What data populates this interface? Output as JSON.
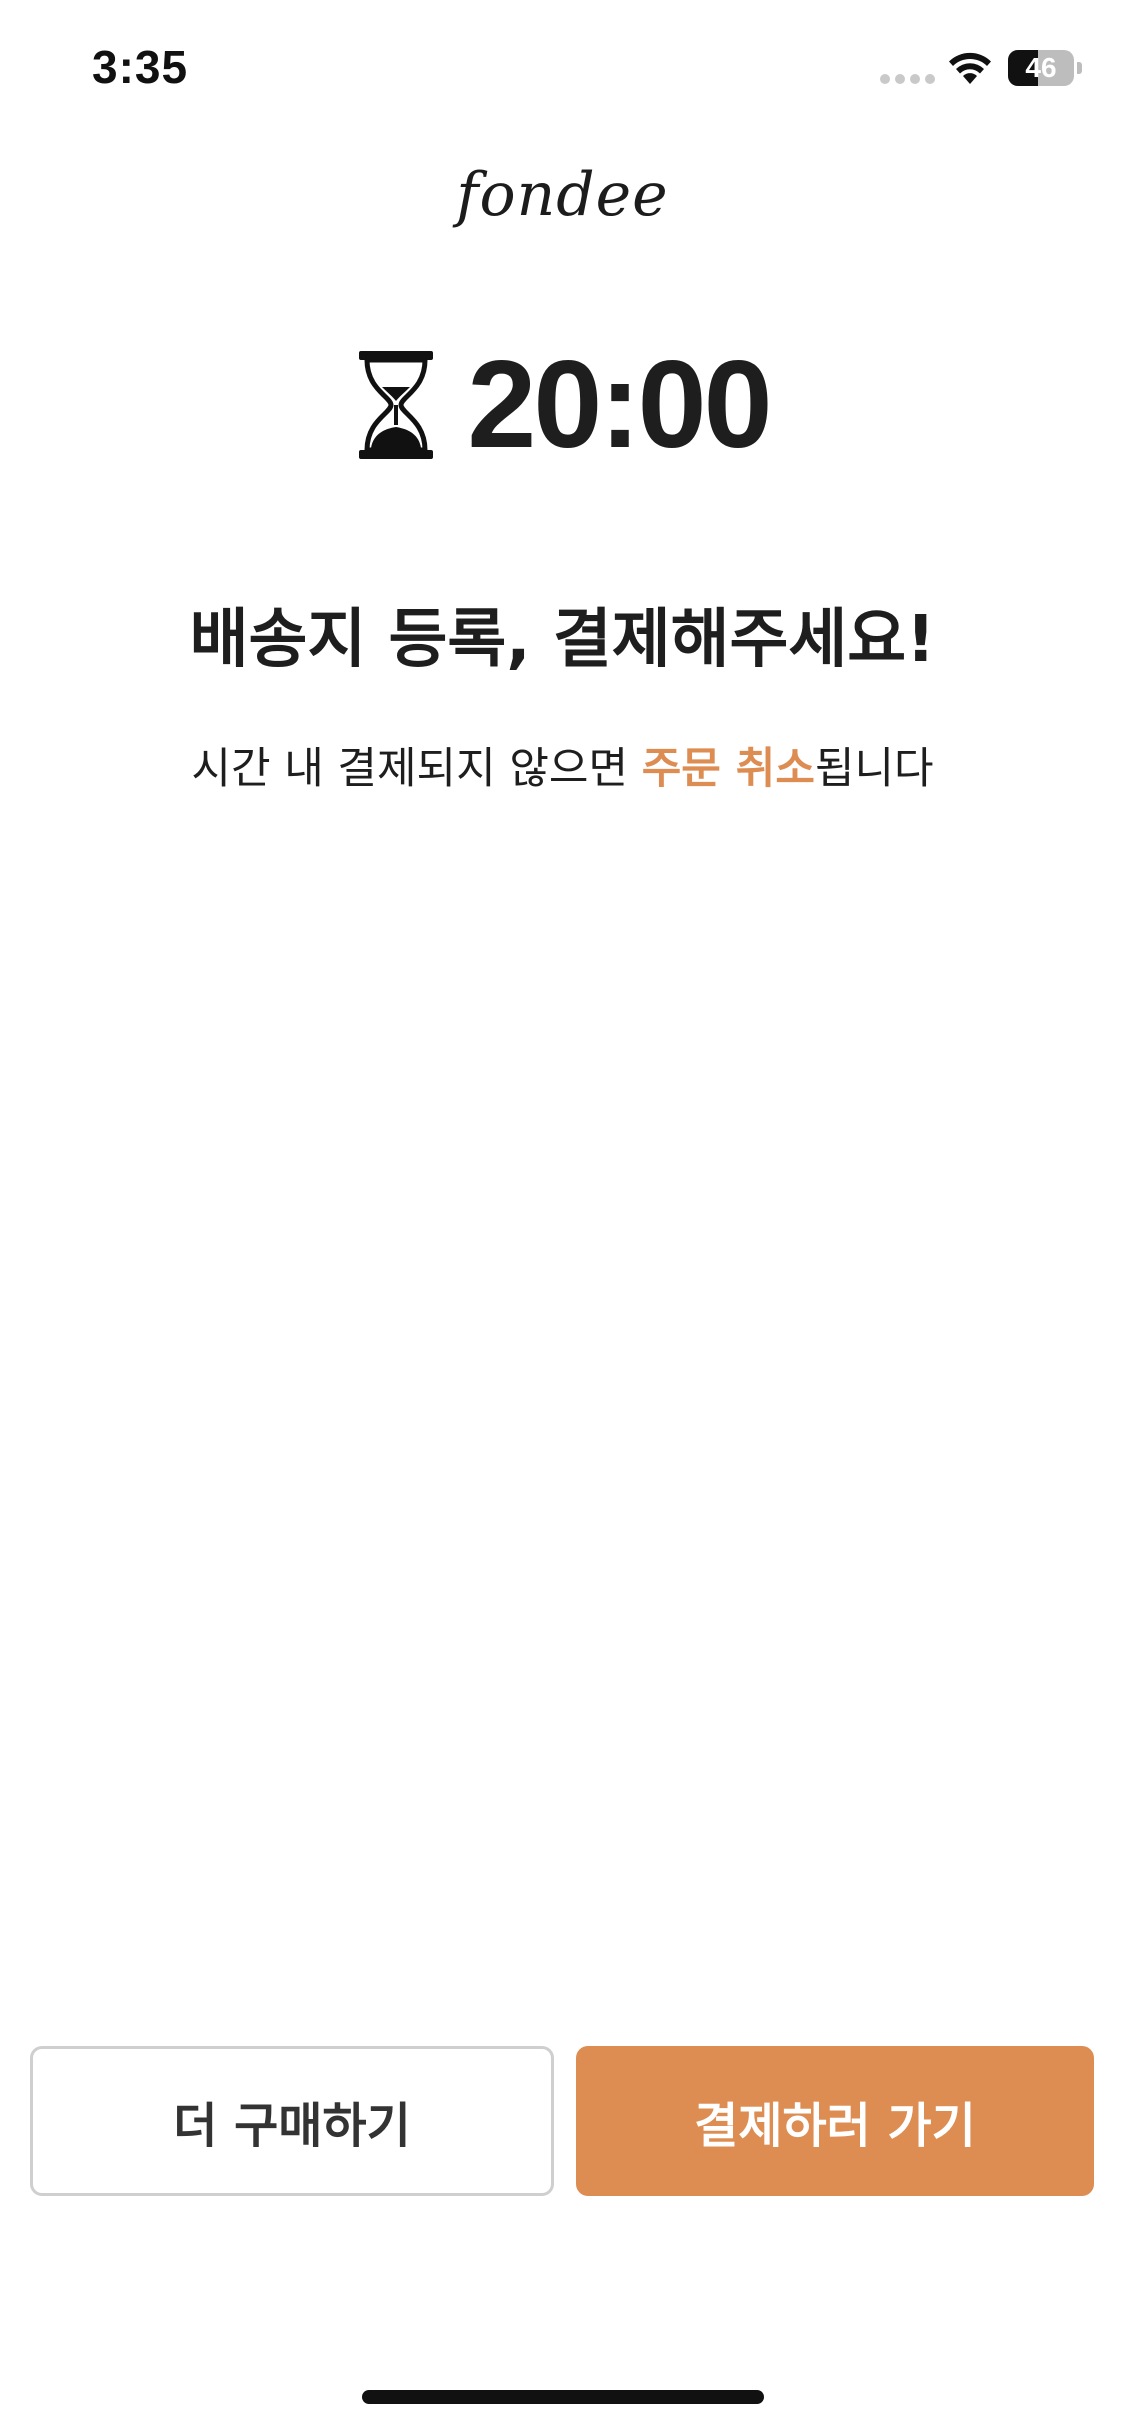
{
  "status_bar": {
    "time": "3:35",
    "battery_level": "46",
    "battery_fraction": 0.46
  },
  "app": {
    "logo_text": "fondee"
  },
  "timer": {
    "icon": "hourglass-icon",
    "value": "20:00"
  },
  "message": {
    "headline": "배송지 등록, 결제해주세요!",
    "subtext_before": "시간 내 결제되지 않으면 ",
    "subtext_accent": "주문 취소",
    "subtext_after": "됩니다"
  },
  "actions": {
    "secondary_label": "더 구매하기",
    "primary_label": "결제하러 가기"
  },
  "colors": {
    "accent": "#dd8c52",
    "text": "#1e1e1e",
    "secondary_border": "#cfcfcf"
  }
}
